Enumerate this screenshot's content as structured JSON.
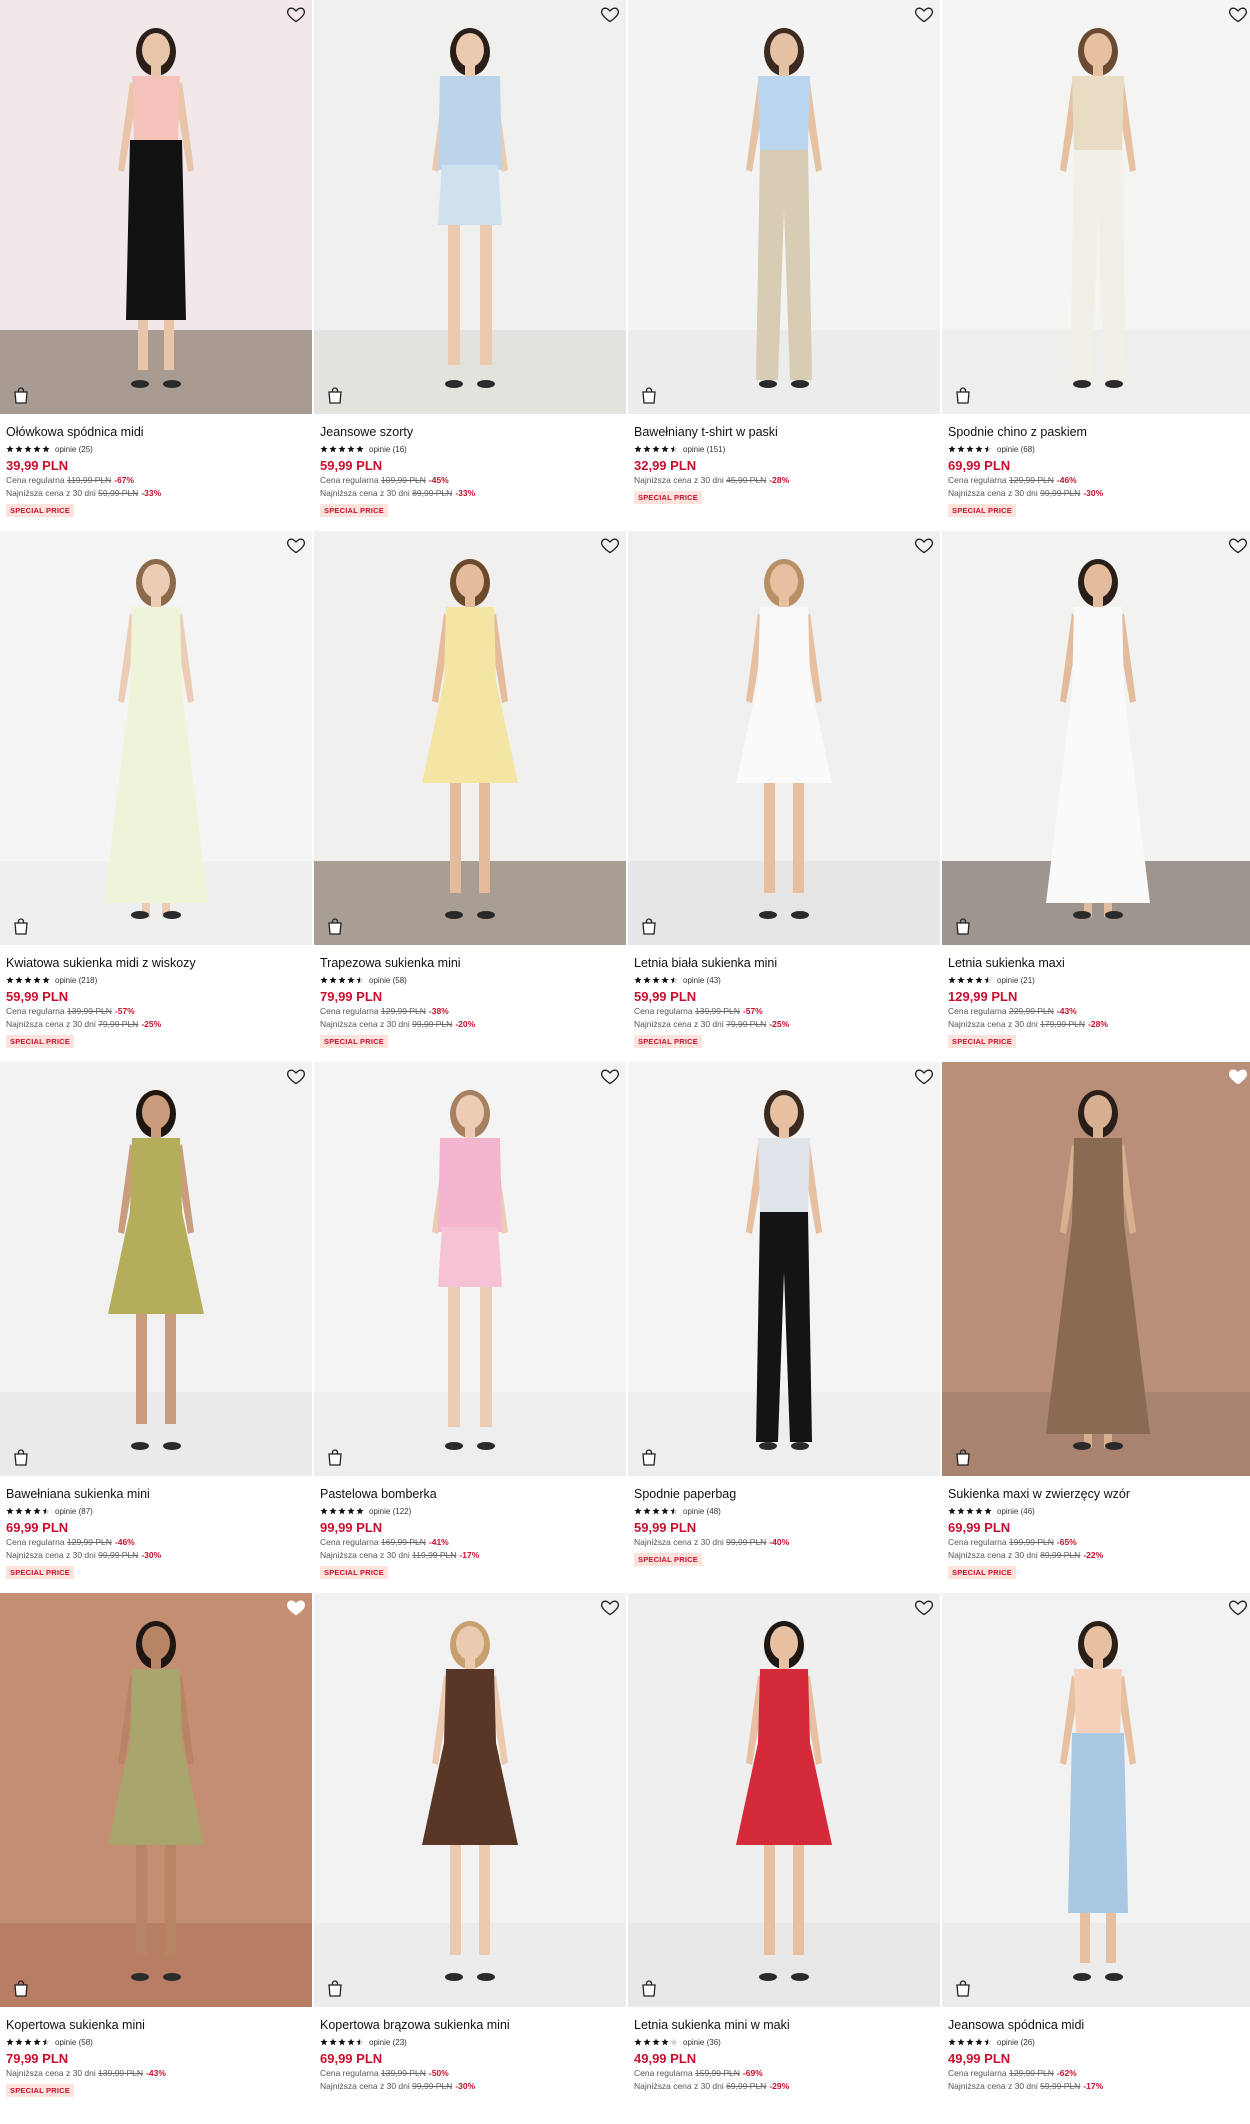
{
  "products": [
    {
      "name": "Ołówkowa spódnica midi",
      "rating": 5,
      "reviews": "opinie (25)",
      "price": "39,99 PLN",
      "lines": [
        {
          "label": "Cena regularna",
          "old": "119,99 PLN",
          "pct": "-67%"
        },
        {
          "label": "Najniższa cena z 30 dni",
          "old": "59,99 PLN",
          "pct": "-33%"
        }
      ],
      "badge": "SPECIAL PRICE",
      "favorite": false,
      "palette": {
        "bg": "#f2e8ea",
        "floor": "#a89c92",
        "top": "#f4c2b8",
        "bottom": "#111111",
        "skin": "#e8c4a8",
        "hair": "#2a1e18"
      },
      "style": "skirt"
    },
    {
      "name": "Jeansowe szorty",
      "rating": 5,
      "reviews": "opinie (16)",
      "price": "59,99 PLN",
      "lines": [
        {
          "label": "Cena regularna",
          "old": "109,99 PLN",
          "pct": "-45%"
        },
        {
          "label": "Najniższa cena z 30 dni",
          "old": "89,99 PLN",
          "pct": "-33%"
        }
      ],
      "badge": "SPECIAL PRICE",
      "favorite": false,
      "palette": {
        "bg": "#f0f0ee",
        "floor": "#e4e2de",
        "top": "#bcd4ea",
        "bottom": "#cfe0ef",
        "skin": "#eccab0",
        "hair": "#2a1e18"
      },
      "style": "shorts"
    },
    {
      "name": "Bawełniany t-shirt w paski",
      "rating": 4.5,
      "reviews": "opinie (151)",
      "price": "32,99 PLN",
      "lines": [
        {
          "label": "Najniższa cena z 30 dni",
          "old": "45,99 PLN",
          "pct": "-28%"
        }
      ],
      "badge": "SPECIAL PRICE",
      "favorite": false,
      "palette": {
        "bg": "#f3f3f3",
        "floor": "#ececec",
        "top": "#b9d6ee",
        "bottom": "#d8cdb4",
        "skin": "#e6c2a4",
        "hair": "#3a2a20"
      },
      "style": "pants"
    },
    {
      "name": "Spodnie chino z paskiem",
      "rating": 4.5,
      "reviews": "opinie (68)",
      "price": "69,99 PLN",
      "lines": [
        {
          "label": "Cena regularna",
          "old": "129,99 PLN",
          "pct": "-46%"
        },
        {
          "label": "Najniższa cena z 30 dni",
          "old": "99,99 PLN",
          "pct": "-30%"
        }
      ],
      "badge": "SPECIAL PRICE",
      "favorite": false,
      "palette": {
        "bg": "#f4f4f2",
        "floor": "#eeeeec",
        "top": "#e8dcc4",
        "bottom": "#f2efe6",
        "skin": "#e6c0a0",
        "hair": "#6a4a32"
      },
      "style": "pants"
    },
    {
      "name": "Kwiatowa sukienka midi z wiskozy",
      "rating": 5,
      "reviews": "opinie (218)",
      "price": "59,99 PLN",
      "lines": [
        {
          "label": "Cena regularna",
          "old": "139,99 PLN",
          "pct": "-57%"
        },
        {
          "label": "Najniższa cena z 30 dni",
          "old": "79,99 PLN",
          "pct": "-25%"
        }
      ],
      "badge": "SPECIAL PRICE",
      "favorite": false,
      "palette": {
        "bg": "#f4f4f4",
        "floor": "#efefef",
        "top": "#eef4d8",
        "bottom": "#e4eec8",
        "skin": "#ecccb4",
        "hair": "#8a6a4a"
      },
      "style": "maxi"
    },
    {
      "name": "Trapezowa sukienka mini",
      "rating": 4.5,
      "reviews": "opinie (58)",
      "price": "79,99 PLN",
      "lines": [
        {
          "label": "Cena regularna",
          "old": "129,99 PLN",
          "pct": "-38%"
        },
        {
          "label": "Najniższa cena z 30 dni",
          "old": "99,99 PLN",
          "pct": "-20%"
        }
      ],
      "badge": "SPECIAL PRICE",
      "favorite": false,
      "palette": {
        "bg": "#f2f0ee",
        "floor": "#a89e94",
        "top": "#f3e6a4",
        "bottom": "#f3e6a4",
        "skin": "#e4bc9c",
        "hair": "#6a4a2a"
      },
      "style": "mini"
    },
    {
      "name": "Letnia biała sukienka mini",
      "rating": 4.5,
      "reviews": "opinie (43)",
      "price": "59,99 PLN",
      "lines": [
        {
          "label": "Cena regularna",
          "old": "139,99 PLN",
          "pct": "-57%"
        },
        {
          "label": "Najniższa cena z 30 dni",
          "old": "79,99 PLN",
          "pct": "-25%"
        }
      ],
      "badge": "SPECIAL PRICE",
      "favorite": false,
      "palette": {
        "bg": "#f0f0f0",
        "floor": "#e6e6e6",
        "top": "#fafafa",
        "bottom": "#f6f6f6",
        "skin": "#e6c0a0",
        "hair": "#b89066"
      },
      "style": "mini"
    },
    {
      "name": "Letnia sukienka maxi",
      "rating": 4.5,
      "reviews": "opinie (21)",
      "price": "129,99 PLN",
      "lines": [
        {
          "label": "Cena regularna",
          "old": "229,99 PLN",
          "pct": "-43%"
        },
        {
          "label": "Najniższa cena z 30 dni",
          "old": "179,99 PLN",
          "pct": "-28%"
        }
      ],
      "badge": "SPECIAL PRICE",
      "favorite": false,
      "palette": {
        "bg": "#f2f2f0",
        "floor": "#9e968e",
        "top": "#fafafa",
        "bottom": "#f6f6f4",
        "skin": "#e2bc9c",
        "hair": "#2a1e18"
      },
      "style": "maxi"
    },
    {
      "name": "Bawełniana sukienka mini",
      "rating": 4.5,
      "reviews": "opinie (87)",
      "price": "69,99 PLN",
      "lines": [
        {
          "label": "Cena regularna",
          "old": "129,99 PLN",
          "pct": "-46%"
        },
        {
          "label": "Najniższa cena z 30 dni",
          "old": "99,99 PLN",
          "pct": "-30%"
        }
      ],
      "badge": "SPECIAL PRICE",
      "favorite": false,
      "palette": {
        "bg": "#f2f2f2",
        "floor": "#eaeaea",
        "top": "#b4ae5a",
        "bottom": "#b4ae5a",
        "skin": "#c89c7c",
        "hair": "#1e1610"
      },
      "style": "mini"
    },
    {
      "name": "Pastelowa bomberka",
      "rating": 5,
      "reviews": "opinie (122)",
      "price": "99,99 PLN",
      "lines": [
        {
          "label": "Cena regularna",
          "old": "169,99 PLN",
          "pct": "-41%"
        },
        {
          "label": "Najniższa cena z 30 dni",
          "old": "119,99 PLN",
          "pct": "-17%"
        }
      ],
      "badge": "SPECIAL PRICE",
      "favorite": false,
      "palette": {
        "bg": "#f4f4f4",
        "floor": "#eeeeee",
        "top": "#f4b6ce",
        "bottom": "#f6c2d6",
        "skin": "#ecccb4",
        "hair": "#a68060"
      },
      "style": "shorts"
    },
    {
      "name": "Spodnie paperbag",
      "rating": 4.5,
      "reviews": "opinie (48)",
      "price": "59,99 PLN",
      "lines": [
        {
          "label": "Najniższa cena z 30 dni",
          "old": "99,99 PLN",
          "pct": "-40%"
        }
      ],
      "badge": "SPECIAL PRICE",
      "favorite": false,
      "palette": {
        "bg": "#f4f4f4",
        "floor": "#eeeeee",
        "top": "#dfe4ea",
        "bottom": "#141414",
        "skin": "#e6c0a0",
        "hair": "#3a2a20"
      },
      "style": "pants"
    },
    {
      "name": "Sukienka maxi w zwierzęcy wzór",
      "rating": 5,
      "reviews": "opinie (46)",
      "price": "69,99 PLN",
      "lines": [
        {
          "label": "Cena regularna",
          "old": "199,99 PLN",
          "pct": "-65%"
        },
        {
          "label": "Najniższa cena z 30 dni",
          "old": "89,99 PLN",
          "pct": "-22%"
        }
      ],
      "badge": "SPECIAL PRICE",
      "favorite": true,
      "palette": {
        "bg": "#b8907a",
        "floor": "#a88470",
        "top": "#8a6a52",
        "bottom": "#9c7a60",
        "skin": "#d8b090",
        "hair": "#2a1e18"
      },
      "style": "maxi"
    },
    {
      "name": "Kopertowa sukienka mini",
      "rating": 4.5,
      "reviews": "opinie (58)",
      "price": "79,99 PLN",
      "lines": [
        {
          "label": "Najniższa cena z 30 dni",
          "old": "139,99 PLN",
          "pct": "-43%"
        }
      ],
      "badge": "SPECIAL PRICE",
      "favorite": true,
      "palette": {
        "bg": "#c48e72",
        "floor": "#b87e64",
        "top": "#a8a66c",
        "bottom": "#a8a66c",
        "skin": "#b88466",
        "hair": "#1e1610"
      },
      "style": "mini"
    },
    {
      "name": "Kopertowa brązowa sukienka mini",
      "rating": 4.5,
      "reviews": "opinie (23)",
      "price": "69,99 PLN",
      "lines": [
        {
          "label": "Cena regularna",
          "old": "139,99 PLN",
          "pct": "-50%"
        },
        {
          "label": "Najniższa cena z 30 dni",
          "old": "99,99 PLN",
          "pct": "-30%"
        }
      ],
      "badge": "",
      "favorite": false,
      "palette": {
        "bg": "#f2f2f2",
        "floor": "#ececec",
        "top": "#5a3626",
        "bottom": "#5a3626",
        "skin": "#eccab0",
        "hair": "#c8a070"
      },
      "style": "mini"
    },
    {
      "name": "Letnia sukienka mini w maki",
      "rating": 4,
      "reviews": "opinie (36)",
      "price": "49,99 PLN",
      "lines": [
        {
          "label": "Cena regularna",
          "old": "159,99 PLN",
          "pct": "-69%"
        },
        {
          "label": "Najniższa cena z 30 dni",
          "old": "69,99 PLN",
          "pct": "-29%"
        }
      ],
      "badge": "",
      "favorite": false,
      "palette": {
        "bg": "#efefef",
        "floor": "#e8e8e8",
        "top": "#d42a3a",
        "bottom": "#d42a3a",
        "skin": "#e6c0a0",
        "hair": "#1e1610"
      },
      "style": "mini"
    },
    {
      "name": "Jeansowa spódnica midi",
      "rating": 4.5,
      "reviews": "opinie (26)",
      "price": "49,99 PLN",
      "lines": [
        {
          "label": "Cena regularna",
          "old": "129,99 PLN",
          "pct": "-62%"
        },
        {
          "label": "Najniższa cena z 30 dni",
          "old": "59,99 PLN",
          "pct": "-17%"
        }
      ],
      "badge": "",
      "favorite": false,
      "palette": {
        "bg": "#f2f2f2",
        "floor": "#ececec",
        "top": "#f6d2bc",
        "bottom": "#a8c8e4",
        "skin": "#e6c0a0",
        "hair": "#2a1e18"
      },
      "style": "skirt"
    }
  ]
}
